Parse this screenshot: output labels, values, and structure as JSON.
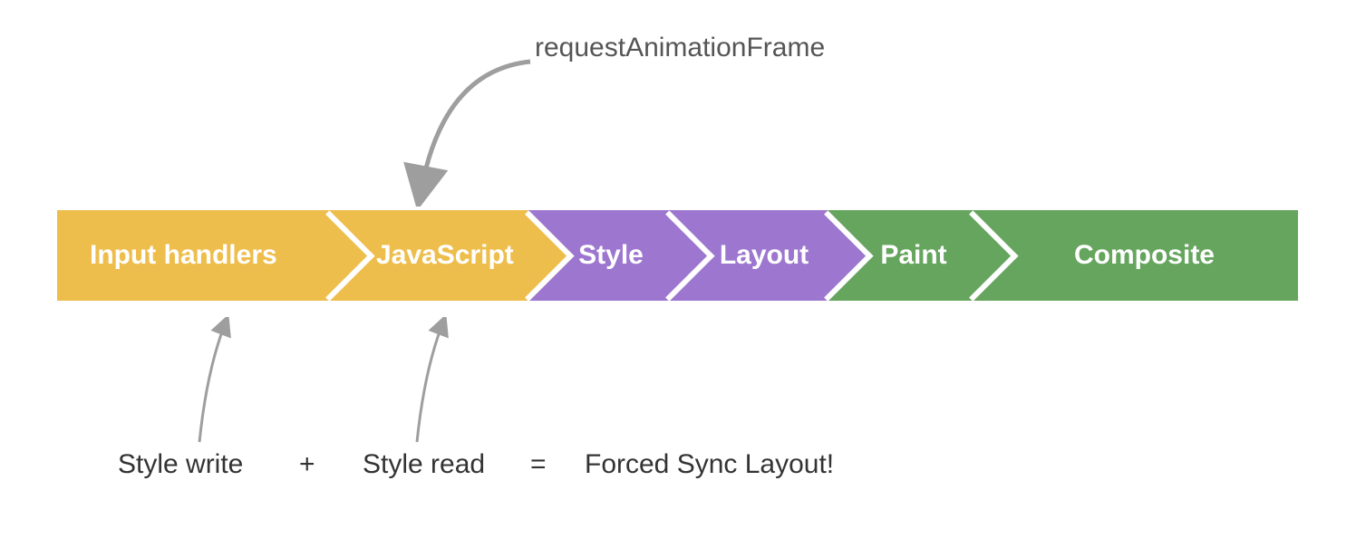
{
  "top_annotation": "requestAnimationFrame",
  "pipeline": {
    "stages": [
      {
        "label": "Input handlers",
        "color": "yellow"
      },
      {
        "label": "JavaScript",
        "color": "yellow"
      },
      {
        "label": "Style",
        "color": "purple"
      },
      {
        "label": "Layout",
        "color": "purple"
      },
      {
        "label": "Paint",
        "color": "green"
      },
      {
        "label": "Composite",
        "color": "green"
      }
    ]
  },
  "equation": {
    "left": "Style write",
    "plus": "+",
    "right": "Style read",
    "equals": "=",
    "result": "Forced Sync Layout!"
  }
}
